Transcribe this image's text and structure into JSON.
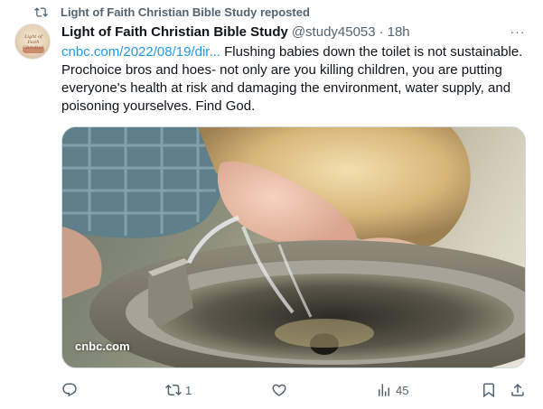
{
  "repost": {
    "icon": "repost-icon",
    "text": "Light of Faith Christian Bible Study reposted"
  },
  "author": {
    "avatar_text": "Light of Faith Christian",
    "display_name": "Light of Faith Christian Bible Study",
    "handle": "@study45053",
    "separator": "·",
    "time": "18h"
  },
  "more_menu": {
    "icon": "more-icon",
    "label": "···"
  },
  "tweet": {
    "link": "cnbc.com/2022/08/19/dir...",
    "body": " Flushing babies down the toilet is not sustainable. Prochoice bros and hoes- not only are you killing children, you are putting everyone's health at risk and damaging the environment, water supply, and poisoning yourselves. Find God."
  },
  "media": {
    "card_domain": "cnbc.com"
  },
  "actions": {
    "reply": {
      "icon": "reply-icon",
      "count": ""
    },
    "repost": {
      "icon": "repost-icon",
      "count": "1",
      "color": "#536471"
    },
    "like": {
      "icon": "heart-icon",
      "count": ""
    },
    "views": {
      "icon": "views-icon",
      "count": "45"
    },
    "bookmark": {
      "icon": "bookmark-icon"
    },
    "share": {
      "icon": "share-icon"
    }
  },
  "colors": {
    "link": "#1d9bf0",
    "text": "#0f1419",
    "secondary": "#536471"
  }
}
